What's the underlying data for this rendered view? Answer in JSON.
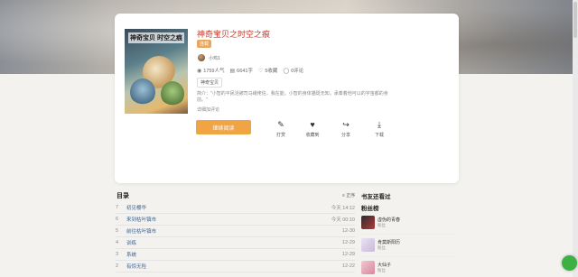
{
  "book": {
    "title": "神奇宝贝之时空之痕",
    "status_tag": "连载",
    "cover_text": "神奇宝贝 时空之痕",
    "author": "小鸡1",
    "stats": {
      "popularity": "1759人气",
      "words": "6641字",
      "likes": "5收藏",
      "comments": "0评论"
    },
    "genre": "神奇宝贝",
    "intro": "简介：\"小智的平民活被司马峨佬信，我在能，小智的身体猫斑无知，承奏着他可以的宇宙都的身前。\"",
    "more": "详细加评论"
  },
  "actions": {
    "read_label": "继续阅读",
    "tip": "打赏",
    "favorite": "收藏到",
    "share": "分享",
    "download": "下载"
  },
  "toc": {
    "title": "目录",
    "order_label": "≡ 正序",
    "chapters": [
      {
        "num": "7",
        "name": "初见樱华",
        "date": "今天 14:12"
      },
      {
        "num": "6",
        "name": "来到枯叶镇市",
        "date": "今天 00:10"
      },
      {
        "num": "5",
        "name": "前往枯叶镇市",
        "date": "12-30"
      },
      {
        "num": "4",
        "name": "训练",
        "date": "12-29"
      },
      {
        "num": "3",
        "name": "系统",
        "date": "12-29"
      },
      {
        "num": "2",
        "name": "有惊无险",
        "date": "12-22"
      }
    ]
  },
  "sidebar": {
    "heading1": "书友还看过",
    "heading2": "粉丝榜",
    "fans": [
      {
        "name": "虚伪的青春",
        "sub": "粉丝"
      },
      {
        "name": "肯莫斯阳历",
        "sub": "粉丝"
      },
      {
        "name": "大仙子",
        "sub": "粉丝"
      }
    ]
  },
  "colors": {
    "accent": "#f0a444",
    "title_red": "#c0392b",
    "link_blue": "#3b5e8c",
    "float_green": "#3cb043"
  }
}
